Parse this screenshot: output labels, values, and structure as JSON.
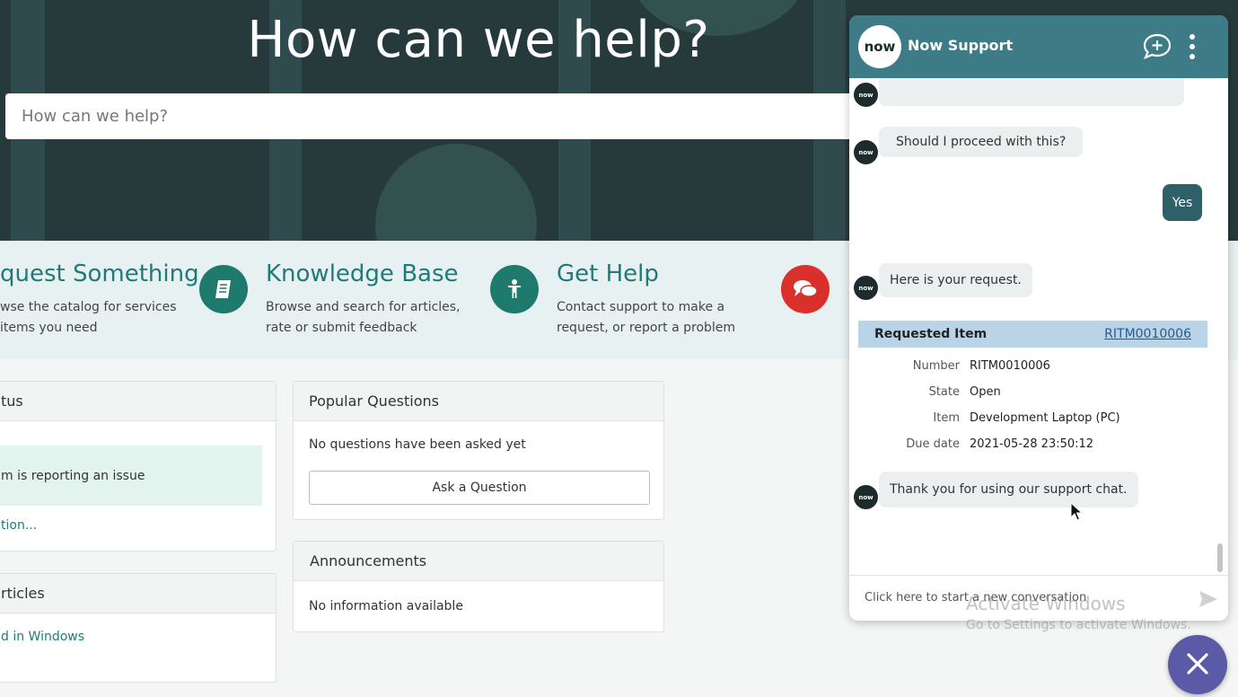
{
  "hero": {
    "title": "How can we help?",
    "search_placeholder": "How can we help?"
  },
  "categories": [
    {
      "title": "quest Something",
      "desc_line1": "wse the catalog for services",
      "desc_line2": "items you need",
      "icon": "none"
    },
    {
      "title": "Knowledge Base",
      "desc_line1": "Browse and search for articles,",
      "desc_line2": "rate or submit feedback",
      "icon": "book-icon",
      "color": "#1f7a6e"
    },
    {
      "title": "Get Help",
      "desc_line1": "Contact support to make a",
      "desc_line2": "request, or report a problem",
      "icon": "person-icon",
      "color": "#1f7a6e"
    },
    {
      "title": "",
      "desc_line1": "",
      "desc_line2": "",
      "icon": "chat-bubbles-icon",
      "color": "#d9302c"
    }
  ],
  "status_card": {
    "title": "tus",
    "issue": "m is reporting an issue",
    "link": "tion..."
  },
  "articles_card": {
    "title": "rticles",
    "link": "d in Windows"
  },
  "popular_questions": {
    "title": "Popular Questions",
    "empty": "No questions have been asked yet",
    "button": "Ask a Question"
  },
  "announcements": {
    "title": "Announcements",
    "empty": "No information available"
  },
  "chat": {
    "title": "Now Support",
    "logo": "now",
    "messages": {
      "proceed": "Should I proceed with this?",
      "yes": "Yes",
      "request": "Here is your request.",
      "thanks": "Thank you for using our support chat."
    },
    "requested_item": {
      "header": "Requested Item",
      "link": "RITM0010006",
      "fields": [
        {
          "label": "Number",
          "value": "RITM0010006"
        },
        {
          "label": "State",
          "value": "Open"
        },
        {
          "label": "Item",
          "value": "Development Laptop (PC)"
        },
        {
          "label": "Due date",
          "value": "2021-05-28 23:50:12"
        }
      ]
    },
    "footer_placeholder": "Click here to start a new conversation"
  },
  "watermark": {
    "line1": "Activate Windows",
    "line2": "Go to Settings to activate Windows."
  },
  "colors": {
    "hero_bg": "#26393b",
    "chat_header": "#3d7c86",
    "user_bubble": "#2e6068",
    "fab": "#5b5aa6",
    "accent": "#1f7a79"
  }
}
